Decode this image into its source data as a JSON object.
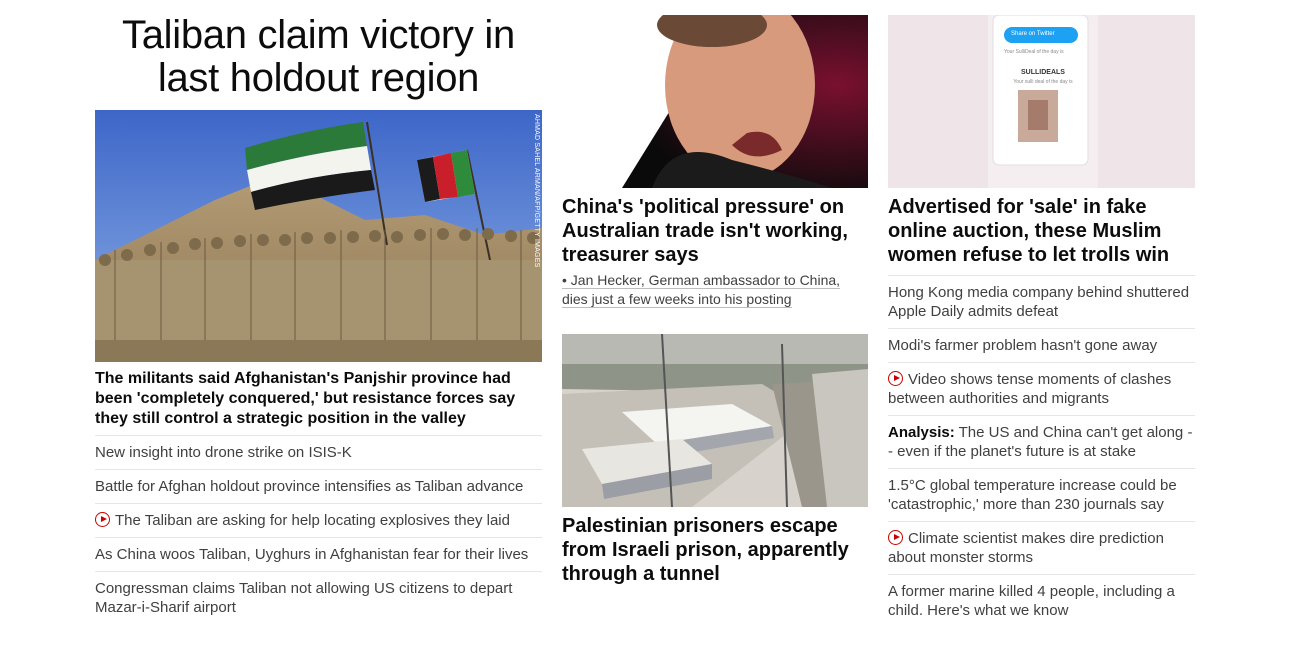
{
  "lead": {
    "headline": "Taliban claim victory in last holdout region",
    "image_credit": "AHMAD SAHEL ARMAN/AFP/GETTY IMAGES",
    "summary": "The militants said Afghanistan's Panjshir province had been 'completely conquered,' but resistance forces say they still control a strategic position in the valley",
    "links": [
      {
        "text": "New insight into drone strike on ISIS-K",
        "video": false
      },
      {
        "text": "Battle for Afghan holdout province intensifies as Taliban advance",
        "video": false
      },
      {
        "text": "The Taliban are asking for help locating explosives they laid",
        "video": true
      },
      {
        "text": "As China woos Taliban, Uyghurs in Afghanistan fear for their lives",
        "video": false
      },
      {
        "text": "Congressman claims Taliban not allowing US citizens to depart Mazar-i-Sharif airport",
        "video": false
      }
    ]
  },
  "middle": {
    "story1": {
      "title": "China's 'political pressure' on Australian trade isn't working, treasurer says",
      "bullet": "• Jan Hecker, German ambassador to China, dies just a few weeks into his posting"
    },
    "story2": {
      "title": "Palestinian prisoners escape from Israeli prison, apparently through a tunnel"
    }
  },
  "right": {
    "story": {
      "title": "Advertised for 'sale' in fake online auction, these Muslim women refuse to let trolls win",
      "image_text": {
        "button": "Share on Twitter",
        "line1": "Your SulliDeal of the day is",
        "brand": "SULLIDEALS",
        "line2": "Your sulli deal of the day is"
      }
    },
    "links": [
      {
        "prefix": "",
        "text": "Hong Kong media company behind shuttered Apple Daily admits defeat",
        "video": false
      },
      {
        "prefix": "",
        "text": "Modi's farmer problem hasn't gone away",
        "video": false
      },
      {
        "prefix": "",
        "text": "Video shows tense moments of clashes between authorities and migrants",
        "video": true
      },
      {
        "prefix": "Analysis:",
        "text": " The US and China can't get along -- even if the planet's future is at stake",
        "video": false
      },
      {
        "prefix": "",
        "text": "1.5°C global temperature increase could be 'catastrophic,' more than 230 journals say",
        "video": false
      },
      {
        "prefix": "",
        "text": "Climate scientist makes dire prediction about monster storms",
        "video": true
      },
      {
        "prefix": "",
        "text": "A former marine killed 4 people, including a child. Here's what we know",
        "video": false
      }
    ]
  },
  "colors": {
    "accent_red": "#cc0000",
    "text": "#262626",
    "divider": "#e6e6e6"
  }
}
